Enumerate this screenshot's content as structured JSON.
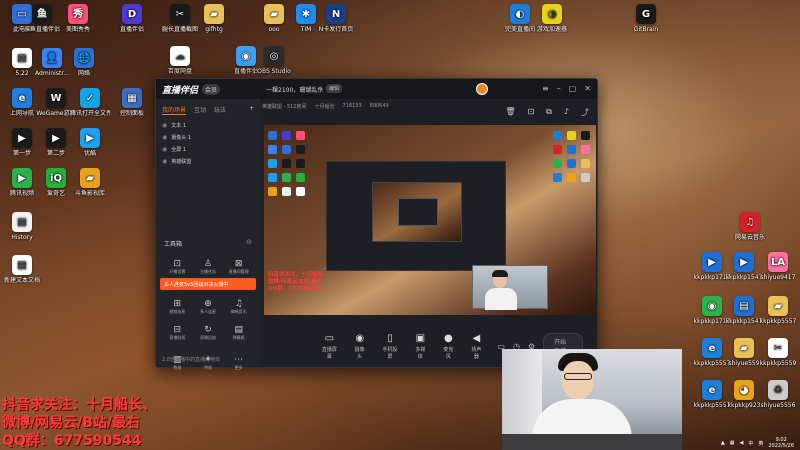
{
  "desktop_icons_left": [
    {
      "label": "此电脑",
      "color": "#2f6fd6",
      "glyph": "▭",
      "icon": "computer-icon"
    },
    {
      "label": "斗鱼直播伴侣",
      "color": "#1a1a1a",
      "glyph": "鱼",
      "icon": "douyu-icon"
    },
    {
      "label": "直播伴侣",
      "color": "#4a3cd0",
      "glyph": "D",
      "icon": "doc-icon"
    },
    {
      "label": "美图秀秀",
      "color": "#ff4f7a",
      "glyph": "秀",
      "icon": "meitu-icon"
    },
    {
      "label": "5.22",
      "color": "#ffffff",
      "glyph": "▤",
      "icon": "file-icon"
    },
    {
      "label": "Administr...",
      "color": "#3b82f6",
      "glyph": "👤",
      "icon": "user-folder-icon"
    },
    {
      "label": "网络",
      "color": "#2f6fd6",
      "glyph": "🌐",
      "icon": "network-icon"
    },
    {
      "label": "控制面板",
      "color": "#3b6fc0",
      "glyph": "▦",
      "icon": "control-panel-icon"
    },
    {
      "label": "上网导航",
      "color": "#1f7fe0",
      "glyph": "e",
      "icon": "ie-icon"
    },
    {
      "label": "WeGame游戏",
      "color": "#1c1c1c",
      "glyph": "W",
      "icon": "wegame-icon"
    },
    {
      "label": "腾讯打开全文件检测器",
      "color": "#13a4e8",
      "glyph": "✓",
      "icon": "tencent-icon"
    },
    {
      "label": "第一步",
      "color": "#1a1a1a",
      "glyph": "▶",
      "icon": "step1-icon"
    },
    {
      "label": "第二步",
      "color": "#1a1a1a",
      "glyph": "▶",
      "icon": "step2-icon"
    },
    {
      "label": "优酷",
      "color": "#1ba0f2",
      "glyph": "▶",
      "icon": "youku-icon"
    },
    {
      "label": "腾讯视频",
      "color": "#2bb24c",
      "glyph": "▶",
      "icon": "tencent-video-icon"
    },
    {
      "label": "爱奇艺",
      "color": "#23b23e",
      "glyph": "iQ",
      "icon": "iqiyi-icon"
    },
    {
      "label": "斗鱼影视库",
      "color": "#e8a21c",
      "glyph": "▰",
      "icon": "folder-icon"
    },
    {
      "label": "History",
      "color": "#f2f2f2",
      "glyph": "▤",
      "icon": "history-icon"
    },
    {
      "label": "新建文本文档",
      "color": "#ffffff",
      "glyph": "▤",
      "icon": "text-file-icon"
    }
  ],
  "desktop_icons_top": [
    {
      "label": "腿长直播截图",
      "color": "#1a1a1a",
      "glyph": "✂",
      "icon": "screenshot-icon"
    },
    {
      "label": "gifhtg",
      "color": "#e8c15a",
      "glyph": "▰",
      "icon": "folder-icon"
    },
    {
      "label": "ooo",
      "color": "#e8c15a",
      "glyph": "▰",
      "icon": "folder-icon"
    },
    {
      "label": "TIM",
      "color": "#1f8cf2",
      "glyph": "✱",
      "icon": "tim-icon"
    },
    {
      "label": "N卡发行首页",
      "color": "#1a3f8a",
      "glyph": "N",
      "icon": "nvidia-icon"
    },
    {
      "label": "百度网盘",
      "color": "#ffffff",
      "glyph": "☁",
      "icon": "baidu-icon"
    },
    {
      "label": "直播伴侣",
      "color": "#3aa0f0",
      "glyph": "◉",
      "icon": "live-icon"
    },
    {
      "label": "OBS Studio",
      "color": "#2b2b2b",
      "glyph": "◎",
      "icon": "obs-icon"
    }
  ],
  "desktop_icons_right": [
    {
      "label": "完美直播间",
      "color": "#1c7ed6",
      "glyph": "◐",
      "icon": "edge-icon"
    },
    {
      "label": "游戏加速器",
      "color": "#e8d11c",
      "glyph": "◑",
      "icon": "speed-icon"
    },
    {
      "label": "GitBrain",
      "color": "#1a1a1a",
      "glyph": "G",
      "icon": "app-icon"
    },
    {
      "label": "网易云音乐",
      "color": "#d8202b",
      "glyph": "♫",
      "icon": "netease-icon"
    },
    {
      "label": "kkpkkp1717",
      "color": "#1f6fd6",
      "glyph": "▶",
      "icon": "teamviewer-icon"
    },
    {
      "label": "kkpkkp1547",
      "color": "#1f6fd6",
      "glyph": "▶",
      "icon": "teamviewer-icon"
    },
    {
      "label": "shiyue9417",
      "color": "#ff6fa0",
      "glyph": "LA",
      "icon": "la-icon"
    },
    {
      "label": "kkpkkp1717",
      "color": "#2bb24c",
      "glyph": "◉",
      "icon": "wechat-icon"
    },
    {
      "label": "kkpkkp1547",
      "color": "#1f6fd6",
      "glyph": "▤",
      "icon": "box-icon"
    },
    {
      "label": "kkpkkp5557",
      "color": "#e8c15a",
      "glyph": "▰",
      "icon": "folder-icon"
    },
    {
      "label": "kkpkkp5557",
      "color": "#1c7ed6",
      "glyph": "e",
      "icon": "edge-icon"
    },
    {
      "label": "shiyue559",
      "color": "#e8c15a",
      "glyph": "▰",
      "icon": "folder-icon"
    },
    {
      "label": "kkpkkp5559",
      "color": "#ffffff",
      "glyph": "✂",
      "icon": "capcut-icon"
    },
    {
      "label": "kkpkkp5557",
      "color": "#1c7ed6",
      "glyph": "e",
      "icon": "edge-icon"
    },
    {
      "label": "kkpkkp923",
      "color": "#e8a21c",
      "glyph": "◕",
      "icon": "cat-icon"
    },
    {
      "label": "shiyue5556",
      "color": "#cccccc",
      "glyph": "♻",
      "icon": "recycle-icon"
    }
  ],
  "app": {
    "logo": "直播伴侣",
    "badge": "会员",
    "room_title": "一棵2100，珊瑚乱杀",
    "room_edit": "编辑",
    "sub_info": [
      "英雄联盟 - 512房间",
      "十月船长",
      "718133",
      "890649"
    ],
    "tabs": [
      "我的场景",
      "互动",
      "玩法"
    ],
    "tabs_plus": "+",
    "sources": [
      "文本 1",
      "摄像头 1",
      "全屏 1",
      "英雄联盟"
    ],
    "tools_title": "工具箱",
    "promo": "多人连麦5v5团战对决火爆中",
    "tools_top": [
      "开播设置",
      "主播任务",
      "直播间管理"
    ],
    "tools_mid": [
      "视频连麦",
      "多人连麦",
      "嗨唱音乐"
    ],
    "tools_low": [
      "直播贴纸",
      "直播回放",
      "弹幕姬",
      "数据",
      "特效",
      "更多"
    ],
    "sidebar_foot": "2.8倍直播中的直播间特效",
    "bottom": [
      {
        "label": "直播屏幕",
        "glyph": "▭"
      },
      {
        "label": "摄像头",
        "glyph": "◉"
      },
      {
        "label": "手机投屏",
        "glyph": "▯"
      },
      {
        "label": "多媒体",
        "glyph": "▣"
      },
      {
        "label": "麦克风",
        "glyph": "🎙"
      },
      {
        "label": "扬声器",
        "glyph": "🔊"
      }
    ],
    "go_live": "开始直播",
    "preview_text": [
      "抖音求关注、十月船长、",
      "微博/网易云/B站/最右",
      "QQ群：677590544"
    ]
  },
  "overlay": {
    "lines": [
      "抖音求关注：十月船长、",
      "微博/网易云/B站/最右",
      "QQ群：677590544"
    ]
  },
  "tray": {
    "ime": "中",
    "lang": "英",
    "time": "9:02",
    "date": "2022/5/26"
  }
}
